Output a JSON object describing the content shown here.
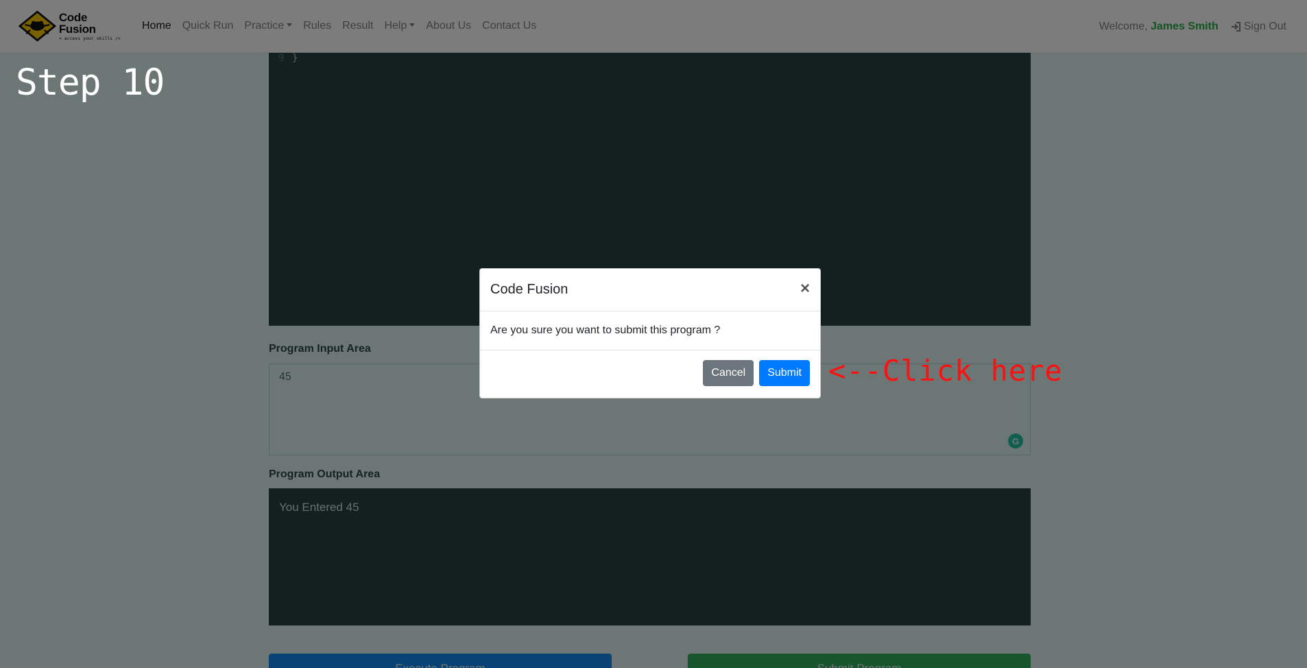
{
  "navbar": {
    "brand_name": "Code Fusion",
    "brand_tagline": "< access your skills />",
    "links": [
      {
        "label": "Home",
        "active": true
      },
      {
        "label": "Quick Run"
      },
      {
        "label": "Practice",
        "dropdown": true
      },
      {
        "label": "Rules"
      },
      {
        "label": "Result"
      },
      {
        "label": "Help",
        "dropdown": true
      },
      {
        "label": "About Us"
      },
      {
        "label": "Contact Us"
      }
    ],
    "welcome_text": "Welcome,",
    "user_name": "James Smith",
    "signout_label": "Sign Out"
  },
  "editor": {
    "line_number": "9",
    "code_line": "}"
  },
  "input_area": {
    "label": "Program Input Area",
    "value": "45"
  },
  "output_area": {
    "label": "Program Output Area",
    "value": "You Entered 45"
  },
  "buttons": {
    "execute": "Execute Program",
    "submit_program": "Submit Program"
  },
  "modal": {
    "title": "Code Fusion",
    "close_symbol": "×",
    "message": "Are you sure you want to submit this program ?",
    "cancel_label": "Cancel",
    "submit_label": "Submit"
  },
  "overlay": {
    "step_label": "Step 10",
    "hint_label": "<--Click here",
    "hint_color": "#ff1010"
  },
  "colors": {
    "primary": "#007bff",
    "success": "#28a745",
    "secondary": "#6c757d"
  }
}
